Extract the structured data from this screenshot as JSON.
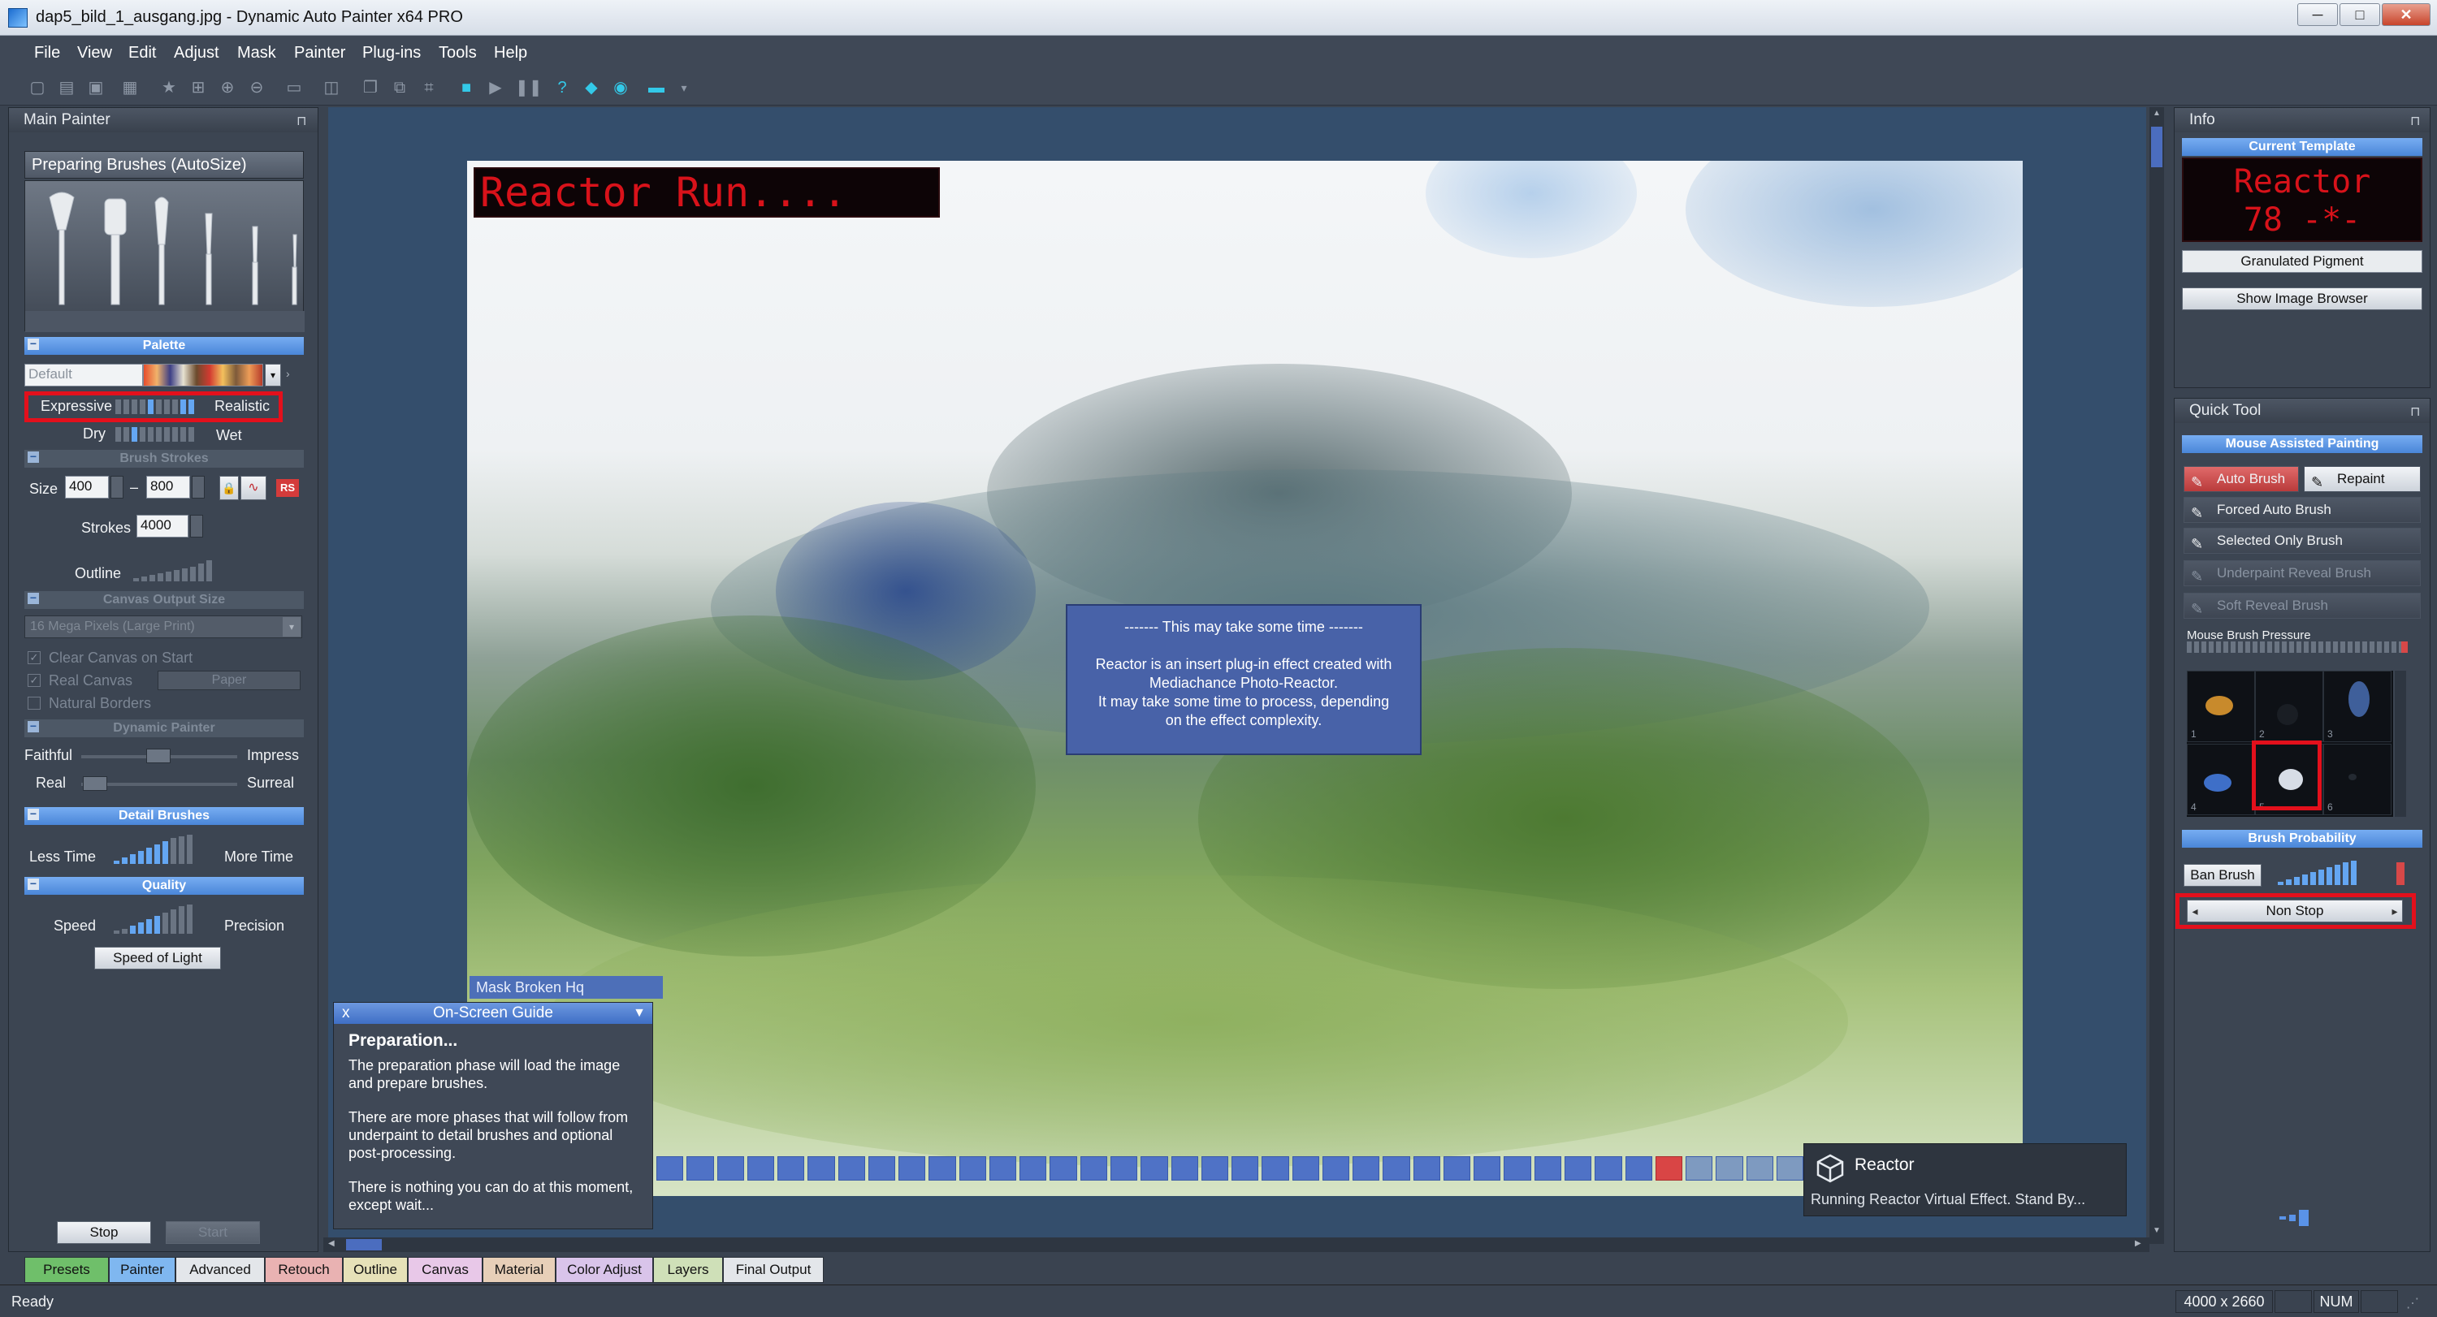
{
  "window": {
    "title": "dap5_bild_1_ausgang.jpg - Dynamic Auto Painter x64 PRO",
    "minimize": "─",
    "maximize": "□",
    "close": "✕"
  },
  "menu": [
    "File",
    "View",
    "Edit",
    "Adjust",
    "Mask",
    "Painter",
    "Plug-ins",
    "Tools",
    "Help"
  ],
  "main_painter": {
    "title": "Main Painter",
    "brush_header": "Preparing Brushes (AutoSize)",
    "palette": {
      "section": "Palette",
      "preset": "Default"
    },
    "style": {
      "left": "Expressive",
      "right": "Realistic",
      "dry": "Dry",
      "wet": "Wet"
    },
    "brush_strokes": {
      "section": "Brush Strokes",
      "size_label": "Size",
      "size_min": "400",
      "dash": "–",
      "size_max": "800",
      "rs": "RS",
      "strokes_label": "Strokes",
      "strokes": "4000",
      "outline_label": "Outline"
    },
    "canvas_output": {
      "section": "Canvas Output Size",
      "size": "16 Mega Pixels (Large Print)",
      "clear": "Clear Canvas on Start",
      "real": "Real Canvas",
      "paper": "Paper",
      "natural": "Natural Borders"
    },
    "dynamic_painter": {
      "section": "Dynamic Painter",
      "faithful": "Faithful",
      "impress": "Impress",
      "real": "Real",
      "surreal": "Surreal"
    },
    "detail": {
      "section": "Detail Brushes",
      "less": "Less Time",
      "more": "More Time"
    },
    "quality": {
      "section": "Quality",
      "speed": "Speed",
      "precision": "Precision",
      "speed_btn": "Speed of Light"
    },
    "stop": "Stop",
    "start": "Start"
  },
  "canvas": {
    "led": "Reactor Run....",
    "msg": {
      "dashes": "------- This may take some time -------",
      "body1": "Reactor is an insert plug-in effect created with",
      "body2": "Mediachance Photo-Reactor.",
      "body3": "It may take some time to process, depending",
      "body4": "on the effect complexity."
    },
    "mask_label": "Mask Broken Hq",
    "progress": {
      "total": 38,
      "filled": 33,
      "current": 34
    }
  },
  "guide": {
    "close": "x",
    "title": "On-Screen Guide",
    "dropdown": "▼",
    "heading": "Preparation...",
    "p1": "The preparation phase will load the image and prepare brushes.",
    "p2": "There are more phases that will follow from underpaint to detail brushes and optional post-processing.",
    "p3": "There is nothing you can do at this moment, except wait..."
  },
  "toast": {
    "title": "Reactor",
    "msg": "Running Reactor Virtual Effect. Stand By..."
  },
  "info": {
    "title": "Info",
    "current_template": "Current Template",
    "led1": "Reactor",
    "led2": "78 -*-",
    "template_name": "Granulated Pigment",
    "browser_btn": "Show Image Browser"
  },
  "quick": {
    "title": "Quick Tool",
    "section": "Mouse Assisted Painting",
    "auto": "Auto Brush",
    "repaint": "Repaint",
    "forced": "Forced Auto Brush",
    "selected": "Selected Only Brush",
    "underpaint": "Underpaint Reveal Brush",
    "soft": "Soft Reveal Brush",
    "pressure": "Mouse Brush Pressure",
    "cells": [
      "1",
      "2",
      "3",
      "4",
      "5",
      "6"
    ],
    "prob_section": "Brush Probability",
    "ban": "Ban Brush",
    "nonstop": "Non Stop",
    "left": "◂",
    "right": "▸"
  },
  "tabs": [
    "Presets",
    "Painter",
    "Advanced",
    "Retouch",
    "Outline",
    "Canvas",
    "Material",
    "Color Adjust",
    "Layers",
    "Final Output"
  ],
  "status": {
    "ready": "Ready",
    "dims": "4000 x 2660",
    "num": "NUM"
  }
}
